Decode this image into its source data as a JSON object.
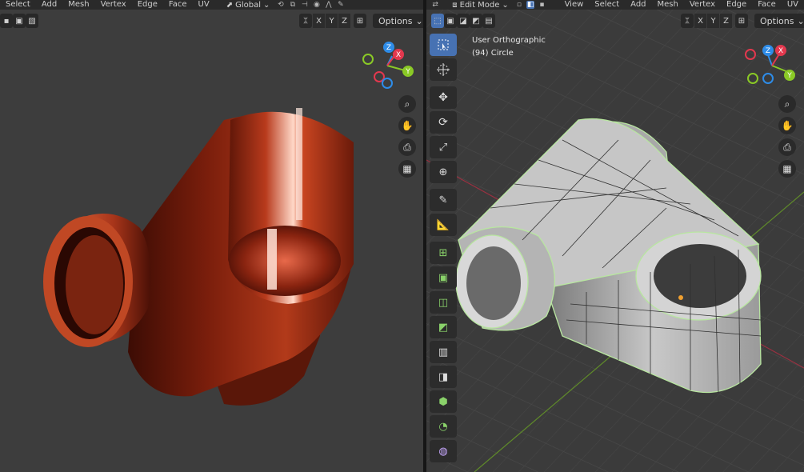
{
  "left_header": {
    "menus": [
      "Select",
      "Add",
      "Mesh",
      "Vertex",
      "Edge",
      "Face",
      "UV"
    ],
    "transform_orientation": "Global"
  },
  "right_header": {
    "mode": "Edit Mode",
    "menus": [
      "View",
      "Select",
      "Add",
      "Mesh",
      "Vertex",
      "Edge",
      "Face",
      "UV"
    ]
  },
  "axes": {
    "x": "X",
    "y": "Y",
    "z": "Z"
  },
  "options_label": "Options",
  "overlay": {
    "view_name": "User Orthographic",
    "object_info": "(94) Circle"
  },
  "colors": {
    "accent": "#4772b3",
    "axis_x": "#e3384e",
    "axis_y": "#8ac926",
    "axis_z": "#2e8ce8",
    "copper": "#b83a1c",
    "mesh_grey": "#bdbdbd",
    "selection_outline": "#b8e6a0"
  },
  "icons": {
    "nav": [
      "zoom-icon",
      "pan-hand-icon",
      "camera-icon",
      "grid-icon"
    ],
    "tools": [
      "select-box-icon",
      "cursor-icon",
      "move-icon",
      "rotate-icon",
      "scale-icon",
      "transform-icon",
      "annotate-icon",
      "measure-icon",
      "add-cube-icon",
      "extrude-icon",
      "inset-icon",
      "bevel-icon",
      "loop-cut-icon",
      "knife-icon",
      "poly-build-icon",
      "spin-icon",
      "smooth-icon"
    ]
  }
}
